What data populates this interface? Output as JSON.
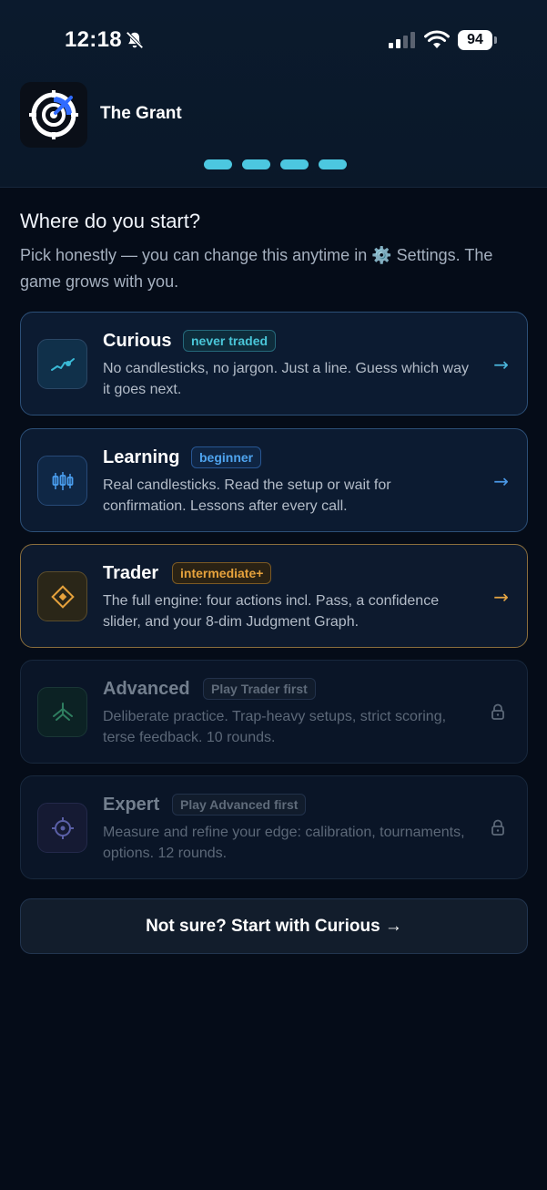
{
  "status_bar": {
    "time": "12:18",
    "battery": "94"
  },
  "app": {
    "title": "The Grant"
  },
  "progress": {
    "steps": 4,
    "completed": 4
  },
  "screen": {
    "heading": "Where do you start?",
    "subtitle_before_icon": "Pick honestly — you can change this anytime in ",
    "gear_glyph": "⚙️",
    "subtitle_after_icon": " Settings. The game grows with you."
  },
  "levels": [
    {
      "title": "Curious",
      "badge": "never traded",
      "description": "No candlesticks, no jargon. Just a line. Guess which way it goes next.",
      "icon": "line-chart-icon",
      "action": "→",
      "locked": false
    },
    {
      "title": "Learning",
      "badge": "beginner",
      "description": "Real candlesticks. Read the setup or wait for confirmation. Lessons after every call.",
      "icon": "candlestick-icon",
      "action": "→",
      "locked": false
    },
    {
      "title": "Trader",
      "badge": "intermediate+",
      "description": "The full engine: four actions incl. Pass, a confidence slider, and your 8-dim Judgment Graph.",
      "icon": "diamond-target-icon",
      "action": "→",
      "locked": false
    },
    {
      "title": "Advanced",
      "badge": "Play Trader first",
      "description": "Deliberate practice. Trap-heavy setups, strict scoring, terse feedback. 10 rounds.",
      "icon": "branch-icon",
      "locked": true
    },
    {
      "title": "Expert",
      "badge": "Play Advanced first",
      "description": "Measure and refine your edge: calibration, tournaments, options. 12 rounds.",
      "icon": "crosshair-icon",
      "locked": true
    }
  ],
  "cta": {
    "label": "Not sure? Start with Curious →"
  },
  "colors": {
    "accent": "#4cc7e0",
    "trader": "#e6a23c",
    "background": "#050c18"
  }
}
